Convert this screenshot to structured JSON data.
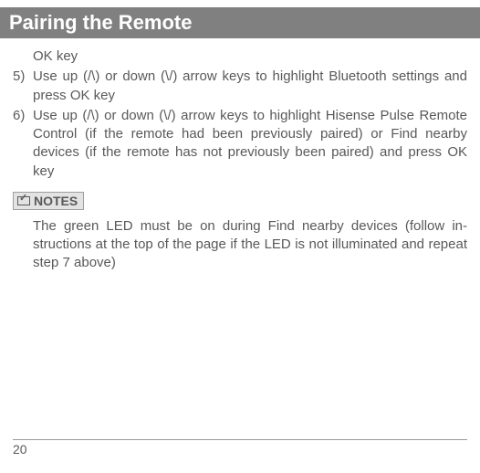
{
  "title": "Pairing the Remote",
  "continued_line": "OK key",
  "steps": [
    {
      "num": "5)",
      "text": "Use up (/\\) or down (\\/) arrow keys to highlight Bluetooth settings and press OK key"
    },
    {
      "num": "6)",
      "text": "Use up (/\\) or down (\\/) arrow keys to highlight Hisense Pulse Re­mote Control (if the remote had been previously paired) or Find nearby devices (if the remote has not previously been paired) and press OK key"
    }
  ],
  "notes_label": "NOTES",
  "notes_body": "The green LED must be on during Find nearby devices (follow in­structions at the top of the page if the LED is not illuminated and repeat step 7 above)",
  "page_number": "20"
}
